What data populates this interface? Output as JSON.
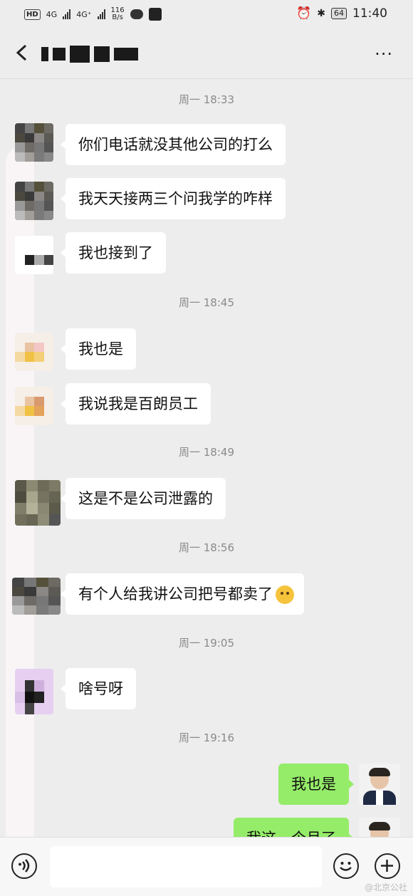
{
  "status_bar": {
    "hd": "HD",
    "net1": "4G",
    "net2": "4G⁺",
    "speed_value": "116",
    "speed_unit": "B/s",
    "battery": "64",
    "time": "11:40"
  },
  "header": {
    "more": "···"
  },
  "messages": [
    {
      "type": "time",
      "text": "周一 18:33"
    },
    {
      "type": "left",
      "text": "你们电话就没其他公司的打么"
    },
    {
      "type": "left",
      "text": "我天天接两三个问我学的咋样"
    },
    {
      "type": "left",
      "text": "我也接到了"
    },
    {
      "type": "time",
      "text": "周一 18:45"
    },
    {
      "type": "left",
      "text": "我也是"
    },
    {
      "type": "left",
      "text": "我说我是百朗员工"
    },
    {
      "type": "time",
      "text": "周一 18:49"
    },
    {
      "type": "left",
      "text": "这是不是公司泄露的"
    },
    {
      "type": "time",
      "text": "周一 18:56"
    },
    {
      "type": "left",
      "text": "有个人给我讲公司把号都卖了"
    },
    {
      "type": "time",
      "text": "周一 19:05"
    },
    {
      "type": "left",
      "text": "啥号呀"
    },
    {
      "type": "time",
      "text": "周一 19:16"
    },
    {
      "type": "right",
      "text": "我也是"
    },
    {
      "type": "right",
      "text": "我这一个月了"
    }
  ],
  "bottom_bar": {
    "input_placeholder": ""
  },
  "watermark": "@北京公社"
}
